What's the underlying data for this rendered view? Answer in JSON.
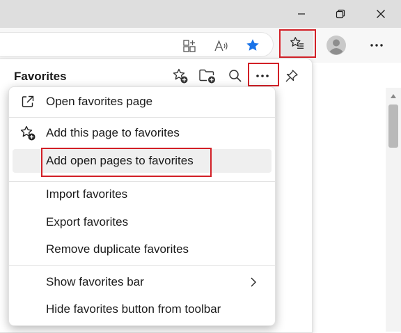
{
  "window": {
    "controls": [
      {
        "name": "minimize-icon"
      },
      {
        "name": "restore-icon"
      },
      {
        "name": "close-icon"
      }
    ]
  },
  "toolbar": {
    "icons": [
      "split-screen-icon",
      "read-aloud-icon",
      "star-filled-icon",
      "favorites-list-icon",
      "avatar-icon",
      "more-icon"
    ],
    "accent": "#1a73e8"
  },
  "favorites": {
    "title": "Favorites",
    "header_icons": [
      "add-favorite-icon",
      "add-folder-icon",
      "search-icon",
      "more-options-icon",
      "pin-icon"
    ]
  },
  "menu": {
    "items": [
      {
        "label": "Open favorites page",
        "icon": "open-external-icon"
      },
      {
        "label": "Add this page to favorites",
        "icon": "add-favorite-icon"
      },
      {
        "label": "Add open pages to favorites",
        "icon": ""
      },
      {
        "label": "Import favorites",
        "icon": ""
      },
      {
        "label": "Export favorites",
        "icon": ""
      },
      {
        "label": "Remove duplicate favorites",
        "icon": ""
      },
      {
        "label": "Show favorites bar",
        "icon": "chevron-right-icon"
      },
      {
        "label": "Hide favorites button from toolbar",
        "icon": ""
      }
    ]
  },
  "highlight_color": "#d21f26"
}
